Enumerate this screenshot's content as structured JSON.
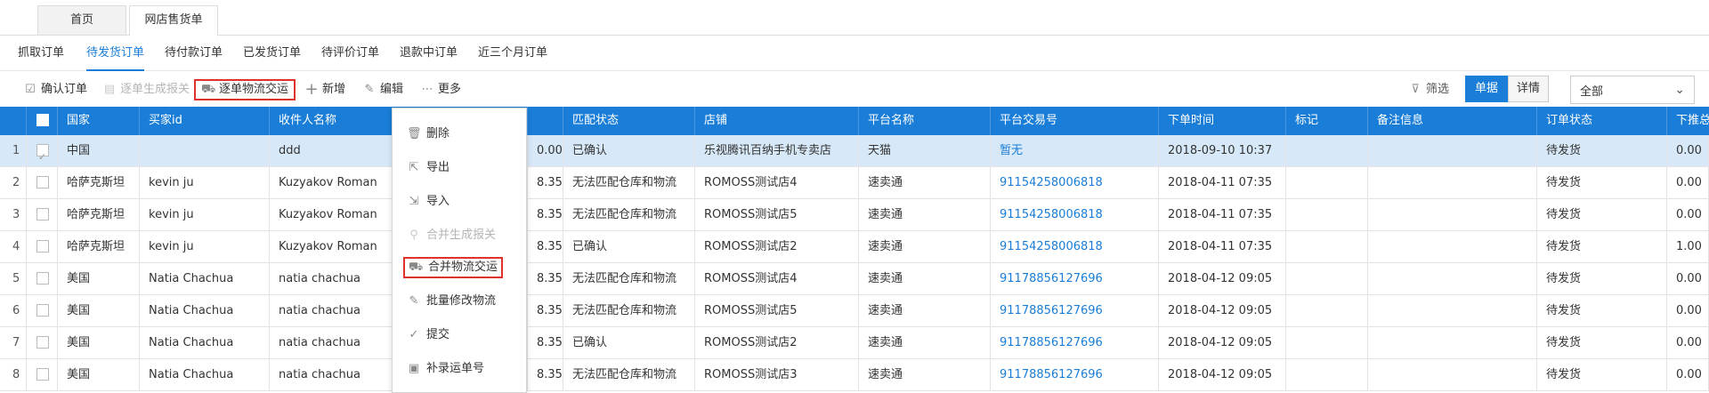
{
  "page_tabs": [
    {
      "label": "首页"
    },
    {
      "label": "网店售货单"
    }
  ],
  "sub_tabs": [
    {
      "label": "抓取订单"
    },
    {
      "label": "待发货订单"
    },
    {
      "label": "待付款订单"
    },
    {
      "label": "已发货订单"
    },
    {
      "label": "待评价订单"
    },
    {
      "label": "退款中订单"
    },
    {
      "label": "近三个月订单"
    }
  ],
  "toolbar": {
    "confirm_label": "确认订单",
    "gen_customs_label": "逐单生成报关",
    "logistics_label": "逐单物流交运",
    "add_label": "新增",
    "edit_label": "编辑",
    "more_label": "更多",
    "filter_label": "筛选",
    "view_list_label": "单据",
    "view_detail_label": "详情",
    "status_select_value": "全部"
  },
  "dropdown": {
    "items": [
      {
        "label": "删除"
      },
      {
        "label": "导出"
      },
      {
        "label": "导入"
      },
      {
        "label": "合并生成报关"
      },
      {
        "label": "合并物流交运"
      },
      {
        "label": "批量修改物流"
      },
      {
        "label": "提交"
      },
      {
        "label": "补录运单号"
      }
    ]
  },
  "table": {
    "headers": {
      "country": "国家",
      "buyer_id": "买家id",
      "receiver": "收件人名称",
      "match_status": "匹配状态",
      "shop": "店铺",
      "platform": "平台名称",
      "trade_no": "平台交易号",
      "order_time": "下单时间",
      "mark": "标记",
      "remark": "备注信息",
      "order_status": "订单状态",
      "down_total": "下推总数"
    },
    "rows": [
      {
        "no": "1",
        "country": "中国",
        "buyer_id": "",
        "receiver": "ddd",
        "amount": "0.00",
        "match_status": "已确认",
        "shop": "乐视腾讯百纳手机专卖店",
        "platform": "天猫",
        "trade_no": "暂无",
        "order_time": "2018-09-10 10:37",
        "order_status": "待发货",
        "down_total": "0.00"
      },
      {
        "no": "2",
        "country": "哈萨克斯坦",
        "buyer_id": "kevin ju",
        "receiver": "Kuzyakov Roman",
        "amount": "8.35",
        "match_status": "无法匹配仓库和物流",
        "shop": "ROMOSS测试店4",
        "platform": "速卖通",
        "trade_no": "91154258006818",
        "order_time": "2018-04-11 07:35",
        "order_status": "待发货",
        "down_total": "0.00"
      },
      {
        "no": "3",
        "country": "哈萨克斯坦",
        "buyer_id": "kevin ju",
        "receiver": "Kuzyakov Roman",
        "amount": "8.35",
        "match_status": "无法匹配仓库和物流",
        "shop": "ROMOSS测试店5",
        "platform": "速卖通",
        "trade_no": "91154258006818",
        "order_time": "2018-04-11 07:35",
        "order_status": "待发货",
        "down_total": "0.00"
      },
      {
        "no": "4",
        "country": "哈萨克斯坦",
        "buyer_id": "kevin ju",
        "receiver": "Kuzyakov Roman",
        "amount": "8.35",
        "match_status": "已确认",
        "shop": "ROMOSS测试店2",
        "platform": "速卖通",
        "trade_no": "91154258006818",
        "order_time": "2018-04-11 07:35",
        "order_status": "待发货",
        "down_total": "1.00"
      },
      {
        "no": "5",
        "country": "美国",
        "buyer_id": "Natia Chachua",
        "receiver": "natia chachua",
        "amount": "8.35",
        "match_status": "无法匹配仓库和物流",
        "shop": "ROMOSS测试店4",
        "platform": "速卖通",
        "trade_no": "91178856127696",
        "order_time": "2018-04-12 09:05",
        "order_status": "待发货",
        "down_total": "0.00"
      },
      {
        "no": "6",
        "country": "美国",
        "buyer_id": "Natia Chachua",
        "receiver": "natia chachua",
        "amount": "8.35",
        "match_status": "无法匹配仓库和物流",
        "shop": "ROMOSS测试店5",
        "platform": "速卖通",
        "trade_no": "91178856127696",
        "order_time": "2018-04-12 09:05",
        "order_status": "待发货",
        "down_total": "0.00"
      },
      {
        "no": "7",
        "country": "美国",
        "buyer_id": "Natia Chachua",
        "receiver": "natia chachua",
        "amount": "8.35",
        "match_status": "已确认",
        "shop": "ROMOSS测试店2",
        "platform": "速卖通",
        "trade_no": "91178856127696",
        "order_time": "2018-04-12 09:05",
        "order_status": "待发货",
        "down_total": "0.00"
      },
      {
        "no": "8",
        "country": "美国",
        "buyer_id": "Natia Chachua",
        "receiver": "natia chachua",
        "amount": "8.35",
        "match_status": "无法匹配仓库和物流",
        "shop": "ROMOSS测试店3",
        "platform": "速卖通",
        "trade_no": "91178856127696",
        "order_time": "2018-04-12 09:05",
        "order_status": "待发货",
        "down_total": "0.00"
      }
    ]
  },
  "colors": {
    "header_blue": "#1a7dd7",
    "link_blue": "#1a7dd7",
    "highlight_red": "#e0312c",
    "selected_row": "#d7e9f8"
  }
}
